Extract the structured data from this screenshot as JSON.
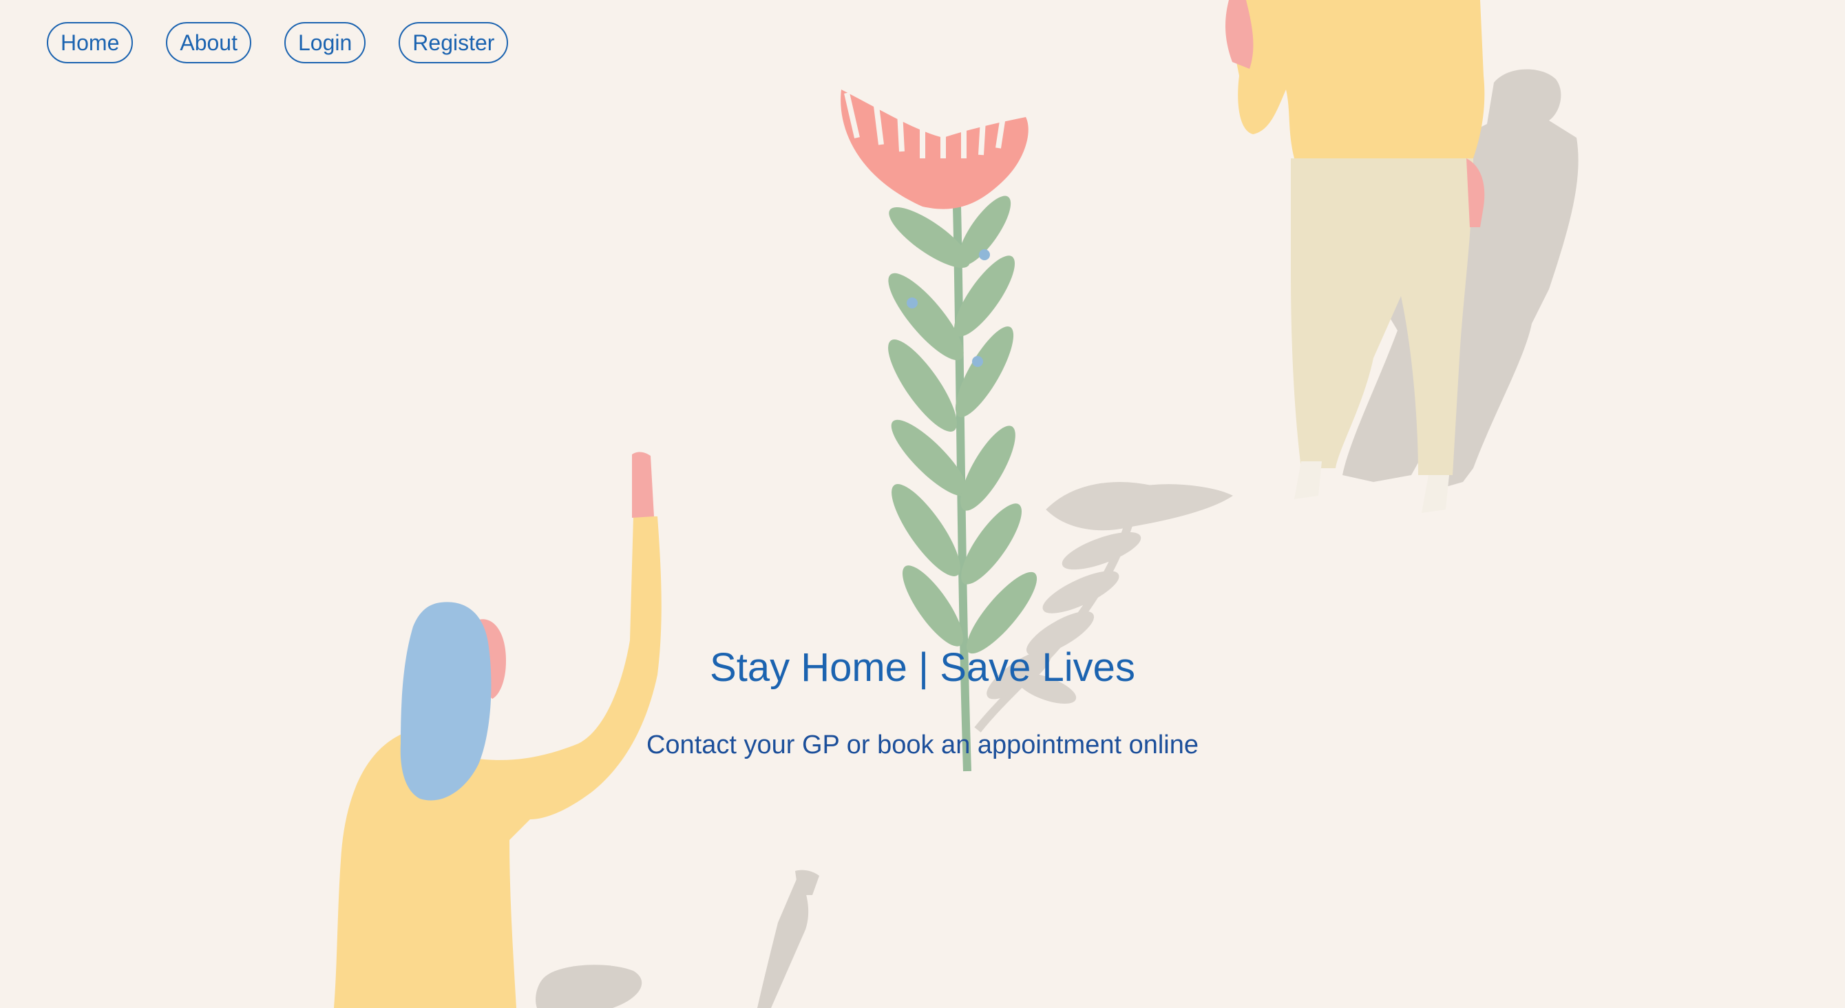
{
  "nav": {
    "items": [
      {
        "label": "Home"
      },
      {
        "label": "About"
      },
      {
        "label": "Login"
      },
      {
        "label": "Register"
      }
    ]
  },
  "hero": {
    "title": "Stay Home | Save Lives",
    "subtitle": "Contact your GP or book an appointment online"
  },
  "colors": {
    "background": "#f8f2ec",
    "accent": "#1b63b0",
    "text_dark": "#1c4f9a"
  }
}
